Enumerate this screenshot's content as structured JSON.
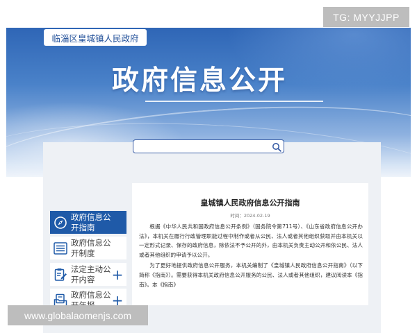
{
  "watermarks": {
    "top": "TG: MYYJJPP",
    "bottom": "www.globalaomenjs.com"
  },
  "header": {
    "site_name": "临淄区皇城镇人民政府",
    "title": "政府信息公开"
  },
  "search": {
    "value": "",
    "icon": "search-icon"
  },
  "sidebar": {
    "items": [
      {
        "label": "政府信息公开指南",
        "icon": "compass-icon",
        "expandable": false
      },
      {
        "label": "政府信息公开制度",
        "icon": "list-icon",
        "expandable": false
      },
      {
        "label": "法定主动公开内容",
        "icon": "clipboard-edit-icon",
        "expandable": true,
        "toggle": "+"
      },
      {
        "label": "政府信息公开年报",
        "icon": "folder-document-icon",
        "expandable": true,
        "toggle": "+"
      }
    ]
  },
  "article": {
    "title": "皇城镇人民政府信息公开指南",
    "date": "时间：2024-02-19",
    "paragraphs": [
      "根据《中华人民共和国政府信息公开条例》（国务院令第711号）、《山东省政府信息公开办法》，本机关在履行行政管理职能过程中制作或者从公民、法人或者其他组织获取并由本机关以一定形式记录、保存的政府信息，除依法不予公开的外，由本机关负责主动公开和依公民、法人或者其他组织的申请予以公开。",
      "为了更好地提供政府信息公开服务，本机关编制了《皇城镇人民政府信息公开指南》（以下简称《指南》）。需要获得本机关政府信息公开服务的公民、法人或者其他组织，建议阅读本《指南》。本《指南》"
    ]
  },
  "colors": {
    "primary": "#1f5aa8",
    "hero_top": "#2f66b6",
    "panel": "#eef1f5"
  }
}
